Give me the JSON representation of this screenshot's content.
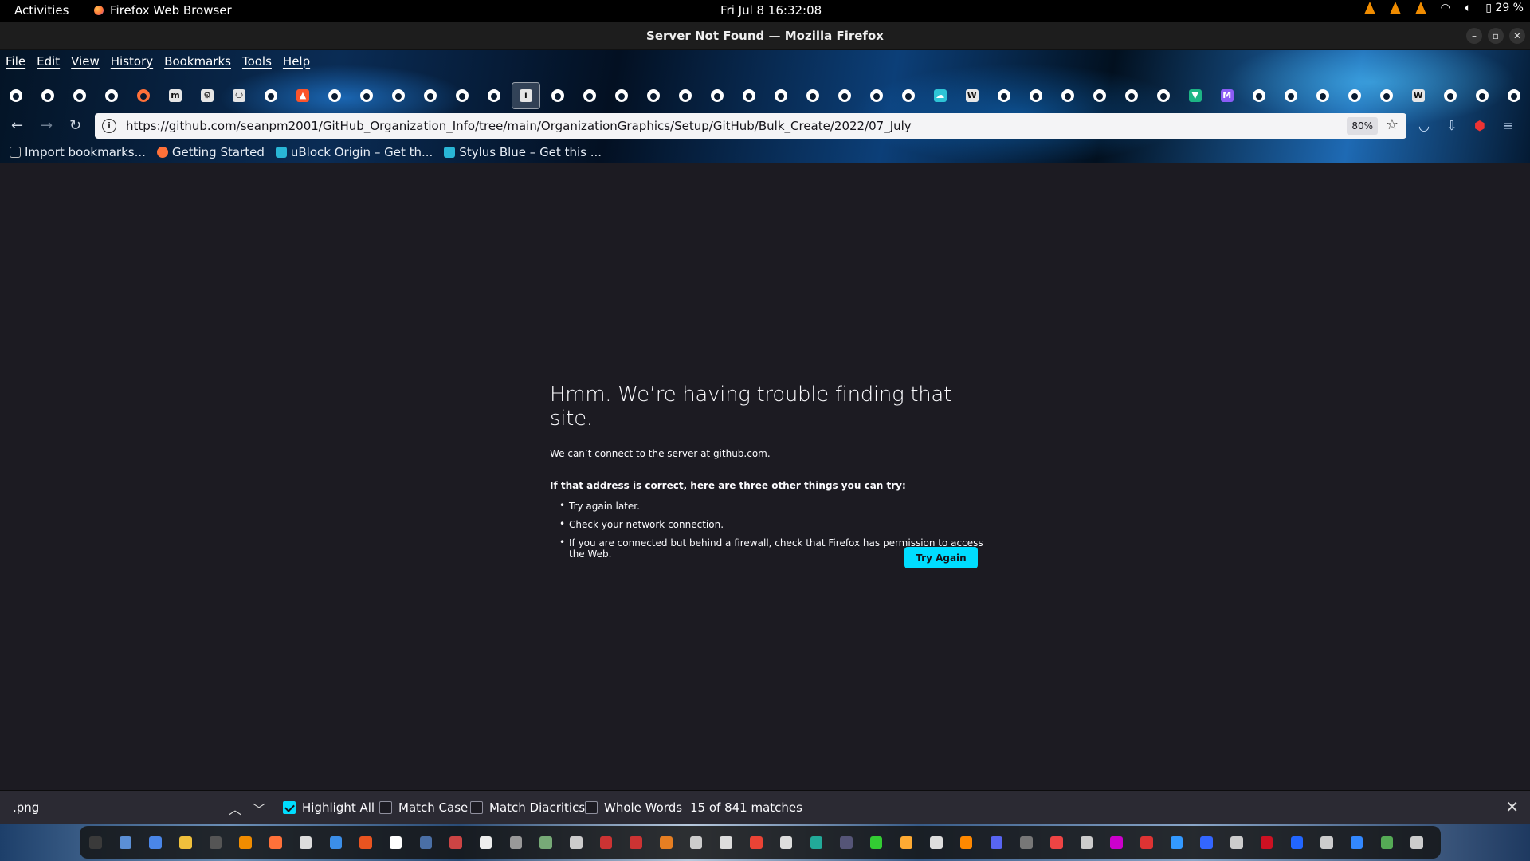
{
  "system": {
    "activities": "Activities",
    "app_name": "Firefox Web Browser",
    "clock": "Fri Jul 8  16:32:08",
    "battery": "29 %"
  },
  "window": {
    "title": "Server Not Found — Mozilla Firefox"
  },
  "menu": [
    "File",
    "Edit",
    "View",
    "History",
    "Bookmarks",
    "Tools",
    "Help"
  ],
  "toolbar_icons": [
    "github",
    "github",
    "github",
    "github",
    "firefox",
    "medium",
    "gear",
    "puzzle",
    "github",
    "brave",
    "github",
    "github",
    "github",
    "github",
    "github",
    "github",
    "info",
    "github",
    "github",
    "github",
    "github",
    "github",
    "github",
    "github",
    "github",
    "github",
    "github",
    "github",
    "github",
    "cloud",
    "wikipedia",
    "github",
    "github",
    "github",
    "github",
    "github",
    "github",
    "vue",
    "proton",
    "github",
    "github",
    "github",
    "github",
    "github",
    "wikipedia",
    "github",
    "github",
    "github"
  ],
  "urlbar": {
    "url": "https://github.com/seanpm2001/GitHub_Organization_Info/tree/main/OrganizationGraphics/Setup/GitHub/Bulk_Create/2022/07_July",
    "zoom": "80%"
  },
  "bookmarks": [
    {
      "label": "Import bookmarks...",
      "color": "#c0c0c0"
    },
    {
      "label": "Getting Started",
      "color": "#ff7139"
    },
    {
      "label": "uBlock Origin – Get th...",
      "color": "#29b6d6"
    },
    {
      "label": "Stylus Blue – Get this ...",
      "color": "#29b6d6"
    }
  ],
  "error": {
    "title": "Hmm. We’re having trouble finding that site.",
    "desc": "We can’t connect to the server at github.com.",
    "suggest_header": "If that address is correct, here are three other things you can try:",
    "suggestions": [
      "Try again later.",
      "Check your network connection.",
      "If you are connected but behind a firewall, check that Firefox has permission to access the Web."
    ],
    "button": "Try Again"
  },
  "findbar": {
    "query": ".png",
    "highlight_all": "Highlight All",
    "match_case": "Match Case",
    "match_diacritics": "Match Diacritics",
    "whole_words": "Whole Words",
    "status": "15 of 841 matches"
  },
  "colors": {
    "accent": "#00ddff",
    "page_bg": "#1c1b22"
  }
}
